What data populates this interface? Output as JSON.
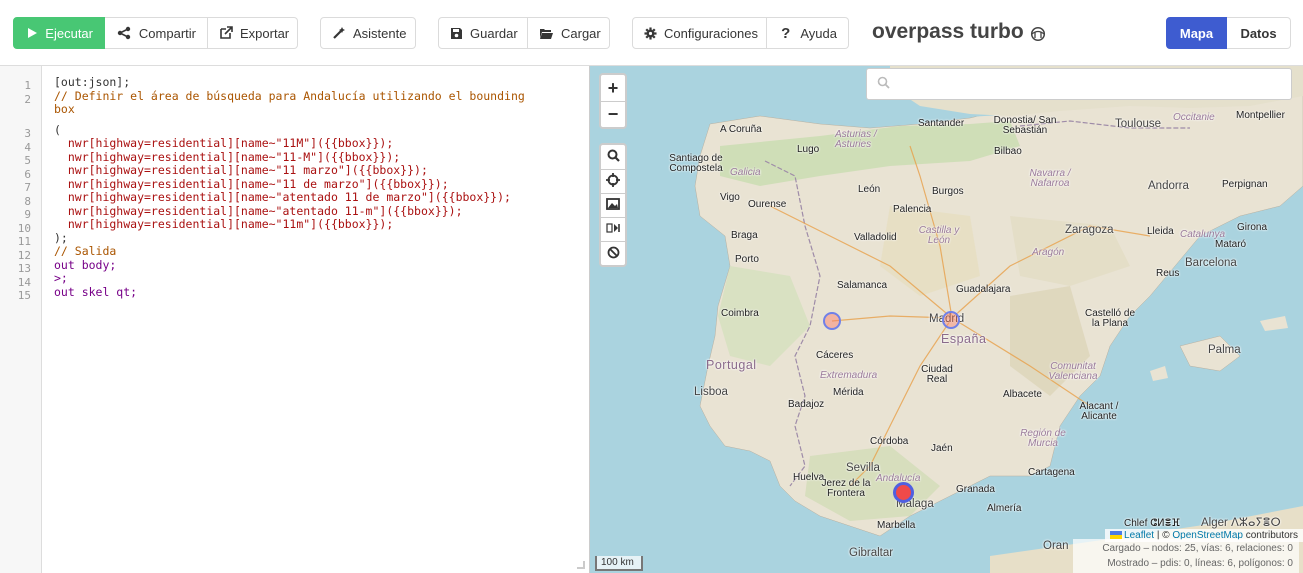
{
  "toolbar": {
    "run_label": "Ejecutar",
    "share_label": "Compartir",
    "export_label": "Exportar",
    "wizard_label": "Asistente",
    "save_label": "Guardar",
    "load_label": "Cargar",
    "settings_label": "Configuraciones",
    "help_label": "Ayuda",
    "brand": "overpass turbo",
    "tab_map": "Mapa",
    "tab_data": "Datos",
    "run_color": "#48c774",
    "tab_active_color": "#3e5cd0"
  },
  "editor": {
    "line_numbers": [
      "1",
      "2",
      "3",
      "4",
      "5",
      "6",
      "7",
      "8",
      "9",
      "10",
      "11",
      "12",
      "13",
      "14",
      "15"
    ],
    "lines": [
      "[out:json];",
      "// Definir el área de búsqueda para Andalucía utilizando el bounding",
      "box",
      "(",
      "  nwr[highway=residential][name~\"11M\"]({{bbox}});",
      "  nwr[highway=residential][name~\"11-M\"]({{bbox}});",
      "  nwr[highway=residential][name~\"11 marzo\"]({{bbox}});",
      "  nwr[highway=residential][name~\"11 de marzo\"]({{bbox}});",
      "  nwr[highway=residential][name~\"atentado 11 de marzo\"]({{bbox}});",
      "  nwr[highway=residential][name~\"atentado 11-m\"]({{bbox}});",
      "  nwr[highway=residential][name~\"11m\"]({{bbox}});",
      ");",
      "// Salida",
      "out body;",
      ">;",
      "out skel qt;"
    ]
  },
  "map": {
    "search_placeholder": "",
    "zoom_in": "+",
    "zoom_out": "−",
    "scale": "100 km",
    "attribution_leaflet": "Leaflet",
    "attribution_sep": " | © ",
    "attribution_osm": "OpenStreetMap",
    "attribution_tail": " contributors",
    "stats_loaded": "Cargado – nodos: 25, vías: 6, relaciones: 0",
    "stats_shown": "Mostrado – pdis: 0, líneas: 6, polígonos: 0",
    "labels": {
      "a_coruna": "A Coruña",
      "lugo": "Lugo",
      "asturias": "Asturias / Asturies",
      "santander": "Santander",
      "donostia": "Donostia/ San Sebastián",
      "toulouse": "Toulouse",
      "occitanie": "Occitanie",
      "montpellier": "Montpellier",
      "santiago": "Santiago de Compostela",
      "galicia": "Galicia",
      "bilbao": "Bilbao",
      "navarra": "Navarra / Nafarroa",
      "andorra": "Andorra",
      "perpignan": "Perpignan",
      "vigo": "Vigo",
      "ourense": "Ourense",
      "leon": "León",
      "burgos": "Burgos",
      "palencia": "Palencia",
      "braga": "Braga",
      "valladolid": "Valladolid",
      "castilla": "Castilla y León",
      "zaragoza": "Zaragoza",
      "lleida": "Lleida",
      "catalunya": "Catalunya",
      "girona": "Girona",
      "mataro": "Mataró",
      "porto": "Porto",
      "aragon": "Aragón",
      "barcelona": "Barcelona",
      "reus": "Reus",
      "salamanca": "Salamanca",
      "guadalajara": "Guadalajara",
      "coimbra": "Coimbra",
      "madrid": "Madrid",
      "espana": "España",
      "castello": "Castelló de la Plana",
      "portugal": "Portugal",
      "caceres": "Cáceres",
      "palma": "Palma",
      "extremadura": "Extremadura",
      "ciudad_real": "Ciudad Real",
      "comunitat": "Comunitat Valenciana",
      "lisboa": "Lisboa",
      "merida": "Mérida",
      "badajoz": "Badajoz",
      "albacete": "Albacete",
      "alacant": "Alacant / Alicante",
      "cordoba": "Córdoba",
      "murcia": "Región de Murcia",
      "jaen": "Jaén",
      "sevilla": "Sevilla",
      "huelva": "Huelva",
      "andalucia": "Andalucía",
      "cartagena": "Cartagena",
      "jerez": "Jerez de la Frontera",
      "granada": "Granada",
      "malaga": "Málaga",
      "almeria": "Almería",
      "marbella": "Marbella",
      "gibraltar": "Gibraltar",
      "oran": "Oran",
      "chlef": "Chlef ⵛⵍⴻⴼ",
      "alger": "Alger ⴷⵣⴰⵢⴻⵔ"
    }
  }
}
